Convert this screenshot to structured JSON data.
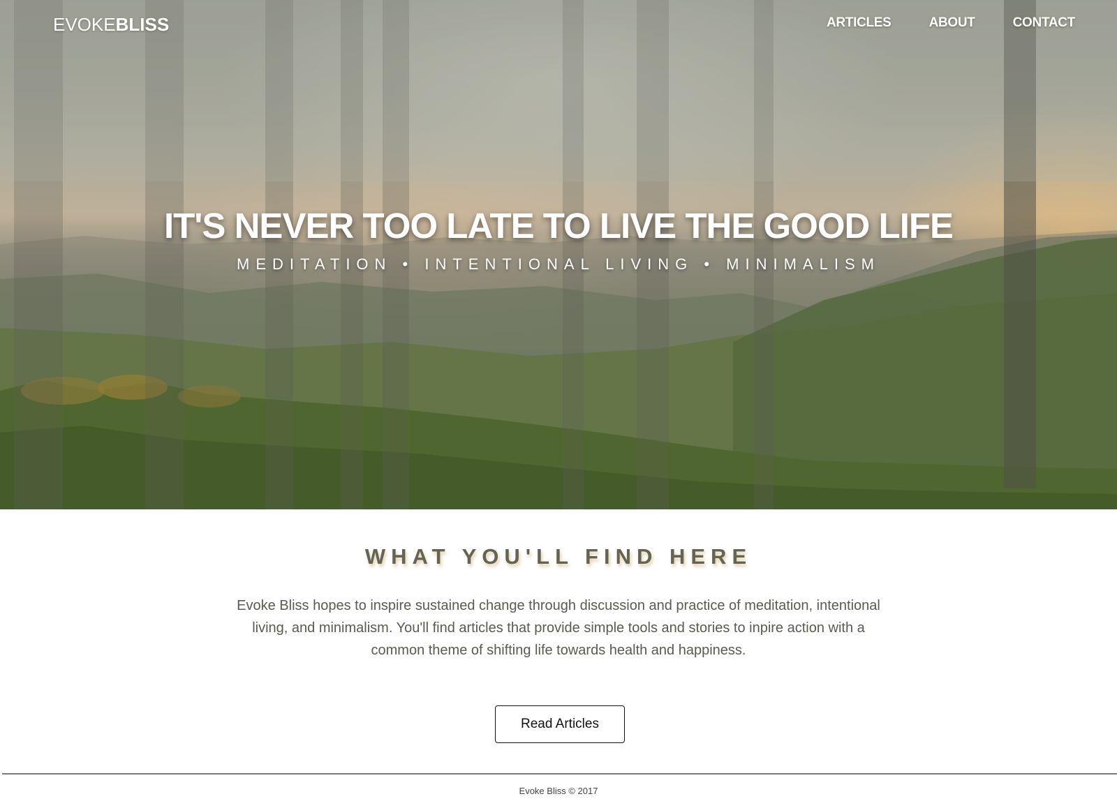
{
  "brand": {
    "light": "EVOKE",
    "bold": "BLISS"
  },
  "nav": {
    "items": [
      {
        "label": "ARTICLES"
      },
      {
        "label": "ABOUT"
      },
      {
        "label": "CONTACT"
      }
    ]
  },
  "hero": {
    "title": "IT'S NEVER TOO LATE TO LIVE THE GOOD LIFE",
    "subtitle": "MEDITATION • INTENTIONAL LIVING • MINIMALISM",
    "image": "misty-forest-mountain-landscape"
  },
  "intro": {
    "heading": "WHAT YOU'LL FIND HERE",
    "body": "Evoke Bliss hopes to inspire sustained change through discussion and practice of meditation, intentional living, and minimalism. You'll find articles that provide simple tools and stories to inpire action with a common theme of shifting life towards health and happiness.",
    "button_label": "Read Articles"
  },
  "footer": {
    "text": "Evoke Bliss © 2017"
  },
  "colors": {
    "heading": "#646453",
    "body_text": "#5a5a50",
    "nav_text": "#ffffff"
  }
}
